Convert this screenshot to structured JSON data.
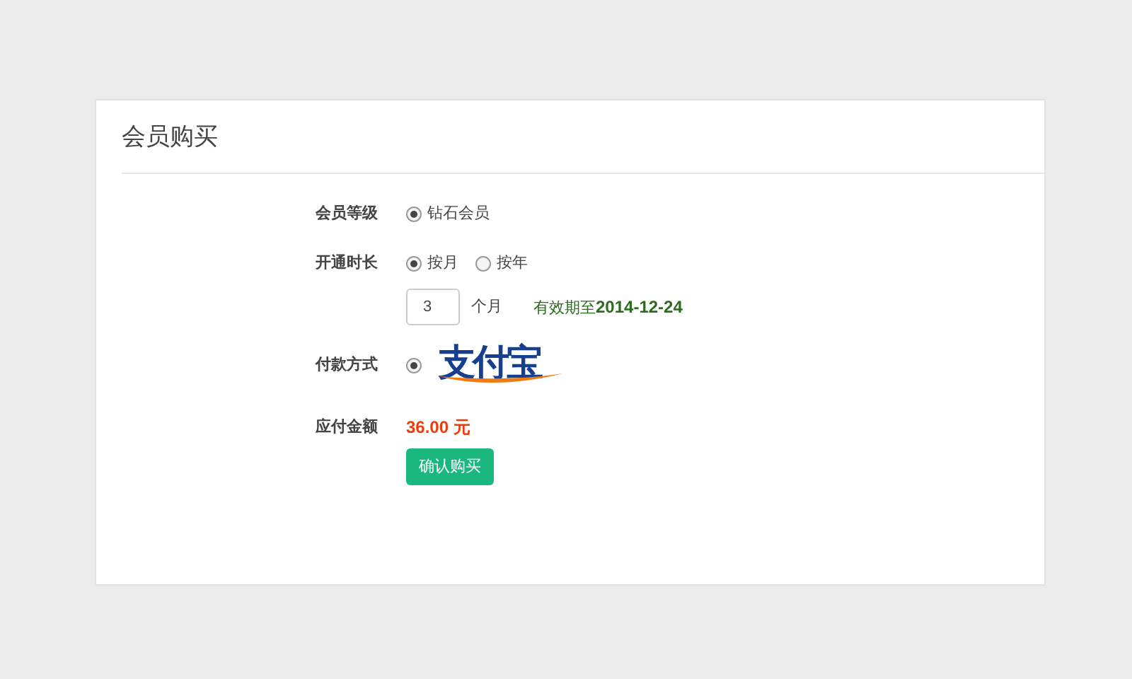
{
  "title": "会员购买",
  "level": {
    "label": "会员等级",
    "options": [
      {
        "label": "钻石会员",
        "selected": true
      }
    ]
  },
  "duration": {
    "label": "开通时长",
    "options": [
      {
        "label": "按月",
        "selected": true
      },
      {
        "label": "按年",
        "selected": false
      }
    ],
    "value": "3",
    "unit": "个月",
    "validity_prefix": "有效期至",
    "validity_date": "2014-12-24"
  },
  "payment": {
    "label": "付款方式",
    "options": [
      {
        "logo": "支付宝",
        "selected": true
      }
    ]
  },
  "amount": {
    "label": "应付金额",
    "value": "36.00 元"
  },
  "submit": "确认购买"
}
